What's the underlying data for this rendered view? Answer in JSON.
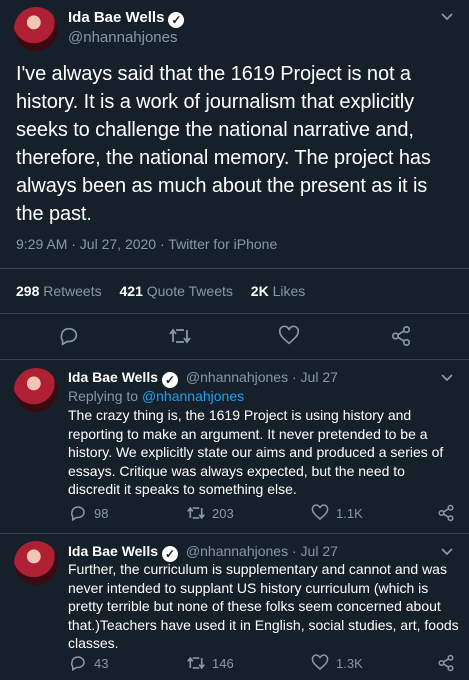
{
  "main_tweet": {
    "author_name": "Ida Bae Wells",
    "handle": "@nhannahjones",
    "text": "I've always said that the 1619 Project is not a history. It is a work of journalism that explicitly seeks to challenge the national narrative and, therefore, the national memory. The project has always been as much about the present as it is the past.",
    "time": "9:29 AM · Jul 27, 2020",
    "source": "Twitter for iPhone",
    "stats": {
      "retweets_count": "298",
      "retweets_label": "Retweets",
      "quotes_count": "421",
      "quotes_label": "Quote Tweets",
      "likes_count": "2K",
      "likes_label": "Likes"
    }
  },
  "replies": [
    {
      "author_name": "Ida Bae Wells",
      "handle": "@nhannahjones",
      "date": "· Jul 27",
      "replying_prefix": "Replying to",
      "replying_handle": "@nhannahjones",
      "text": "The crazy thing is, the 1619 Project is using history and reporting to make an argument. It never pretended to be a history. We explicitly state our aims and produced a series of essays. Critique was always expected, but the need to discredit it speaks to something else.",
      "replies_count": "98",
      "retweets_count": "203",
      "likes_count": "1.1K"
    },
    {
      "author_name": "Ida Bae Wells",
      "handle": "@nhannahjones",
      "date": "· Jul 27",
      "text": "Further, the curriculum is supplementary and cannot and was never intended to supplant US history curriculum (which is pretty terrible but none of these folks seem concerned about that.)Teachers have used it in English, social studies, art, foods classes.",
      "replies_count": "43",
      "retweets_count": "146",
      "likes_count": "1.3K"
    }
  ],
  "icons": {
    "reply": "reply-icon",
    "retweet": "retweet-icon",
    "like": "heart-icon",
    "share": "share-icon",
    "verified": "verified-badge-icon",
    "more": "chevron-down-icon"
  },
  "colors": {
    "background": "#15202b",
    "muted": "#8899a6",
    "link": "#1da1f2",
    "divider": "#38444d"
  }
}
